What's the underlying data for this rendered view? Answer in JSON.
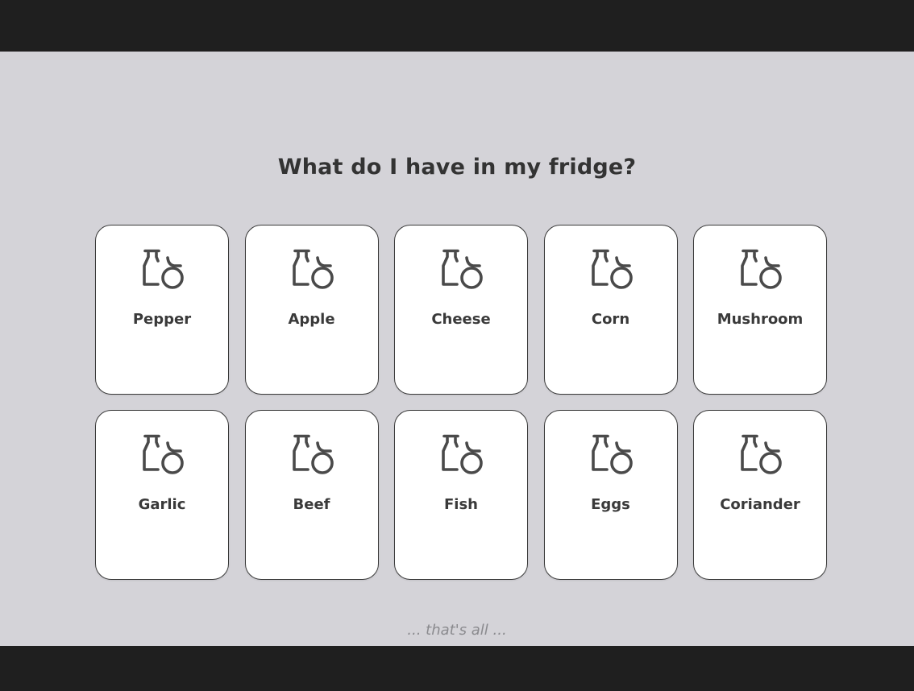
{
  "page": {
    "title": "What do I have in my fridge?",
    "footer": "... that's all ..."
  },
  "colors": {
    "background": "#d4d3d8",
    "frame": "#1f1f1f",
    "card": "#ffffff",
    "text": "#333333",
    "icon": "#4a4a4a"
  },
  "items": [
    {
      "label": "Pepper",
      "icon": "fridge-food-icon"
    },
    {
      "label": "Apple",
      "icon": "fridge-food-icon"
    },
    {
      "label": "Cheese",
      "icon": "fridge-food-icon"
    },
    {
      "label": "Corn",
      "icon": "fridge-food-icon"
    },
    {
      "label": "Mushroom",
      "icon": "fridge-food-icon"
    },
    {
      "label": "Garlic",
      "icon": "fridge-food-icon"
    },
    {
      "label": "Beef",
      "icon": "fridge-food-icon"
    },
    {
      "label": "Fish",
      "icon": "fridge-food-icon"
    },
    {
      "label": "Eggs",
      "icon": "fridge-food-icon"
    },
    {
      "label": "Coriander",
      "icon": "fridge-food-icon"
    }
  ]
}
